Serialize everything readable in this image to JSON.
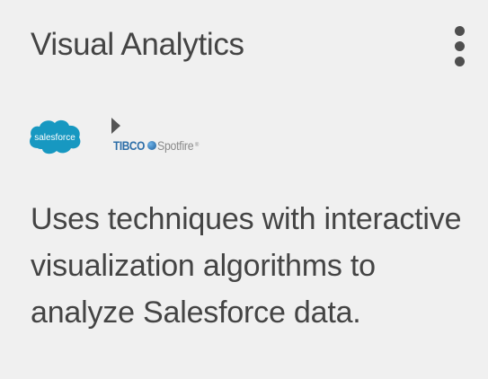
{
  "card": {
    "title": "Visual Analytics",
    "menu_icon": "more-vertical-icon",
    "logos": {
      "source_logo_text": "salesforce",
      "arrow_icon": "play-arrow-icon",
      "target_logo_brand": "TIBCO",
      "target_logo_product": "Spotfire",
      "target_logo_mark": "®"
    },
    "description": "Uses techniques with interactive visualization algorithms to analyze Salesforce data."
  },
  "colors": {
    "background": "#f0f0f0",
    "text": "#444444",
    "salesforce_blue": "#1798c1",
    "tibco_blue": "#2d6ea8",
    "spotfire_gray": "#8a8a8a"
  }
}
